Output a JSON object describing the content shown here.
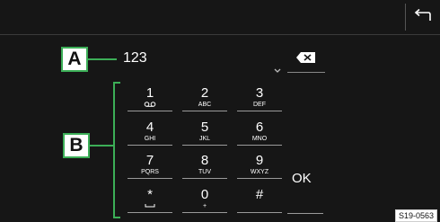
{
  "header": {
    "back_icon": "return-arrow-icon"
  },
  "callouts": {
    "a": "A",
    "b": "B"
  },
  "number_field": {
    "value": "123",
    "dropdown_icon": "chevron-down-icon",
    "delete_icon": "backspace-icon"
  },
  "keypad": {
    "keys": [
      {
        "digit": "1",
        "sub": "",
        "sub_icon": "voicemail-icon"
      },
      {
        "digit": "2",
        "sub": "ABC"
      },
      {
        "digit": "3",
        "sub": "DEF"
      },
      {
        "digit": "4",
        "sub": "GHI"
      },
      {
        "digit": "5",
        "sub": "JKL"
      },
      {
        "digit": "6",
        "sub": "MNO"
      },
      {
        "digit": "7",
        "sub": "PQRS"
      },
      {
        "digit": "8",
        "sub": "TUV"
      },
      {
        "digit": "9",
        "sub": "WXYZ"
      },
      {
        "digit": "*",
        "sub": "",
        "sub_icon": "space-icon"
      },
      {
        "digit": "0",
        "sub": "+"
      },
      {
        "digit": "#",
        "sub": ""
      }
    ],
    "ok_label": "OK"
  },
  "figure_code": "S19-0563",
  "colors": {
    "background": "#161616",
    "callout_green": "#3cae57",
    "text": "#ffffff"
  }
}
